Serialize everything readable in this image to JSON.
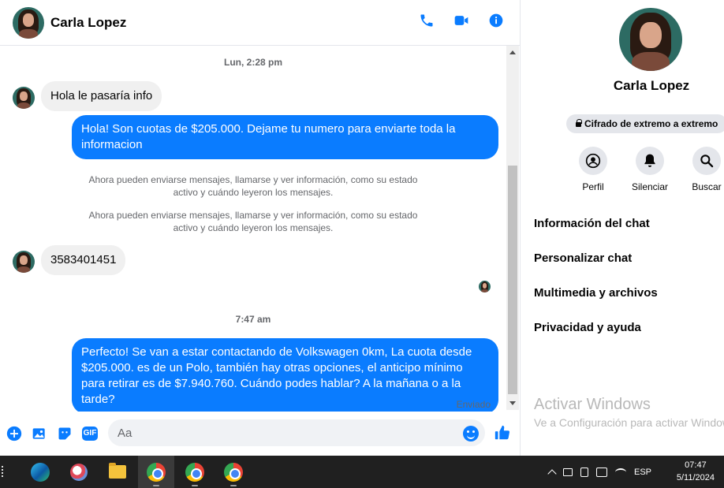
{
  "header": {
    "contact_name": "Carla Lopez",
    "actions": [
      "phone-icon",
      "video-icon",
      "info-icon"
    ]
  },
  "messages": {
    "timestamp_1": "Lun, 2:28 pm",
    "incoming_1": "Hola le pasaría info",
    "outgoing_1": "Hola! Son cuotas de $205.000. Dejame tu numero para enviarte toda la informacion",
    "system_1": "Ahora pueden enviarse mensajes, llamarse y ver información, como su estado activo y cuándo leyeron los mensajes.",
    "system_2": "Ahora pueden enviarse mensajes, llamarse y ver información, como su estado activo y cuándo leyeron los mensajes.",
    "incoming_2": "3583401451",
    "timestamp_2": "7:47 am",
    "outgoing_2": "Perfecto!  Se van a estar contactando de Volkswagen 0km, La cuota desde $205.000. es de un Polo, también hay otras opciones, el anticipo mínimo para retirar es de $7.940.760. Cuándo podes hablar? A la mañana o a la tarde?",
    "sent_status": "Enviado"
  },
  "composer": {
    "placeholder": "Aa",
    "gif_label": "GIF"
  },
  "right_panel": {
    "name": "Carla Lopez",
    "encryption": "Cifrado de extremo a extremo",
    "actions": [
      {
        "label": "Perfil",
        "icon": "profile-icon"
      },
      {
        "label": "Silenciar",
        "icon": "bell-icon"
      },
      {
        "label": "Buscar",
        "icon": "search-icon"
      }
    ],
    "menu": [
      "Información del chat",
      "Personalizar chat",
      "Multimedia y archivos",
      "Privacidad y ayuda"
    ],
    "activate_title": "Activar Windows",
    "activate_sub": "Ve a Configuración para activar Windows."
  },
  "taskbar": {
    "language": "ESP",
    "time": "07:47",
    "date": "5/11/2024"
  },
  "colors": {
    "accent": "#0a7cff",
    "bubble_in": "#f0f0f0",
    "taskbar": "#202020"
  }
}
